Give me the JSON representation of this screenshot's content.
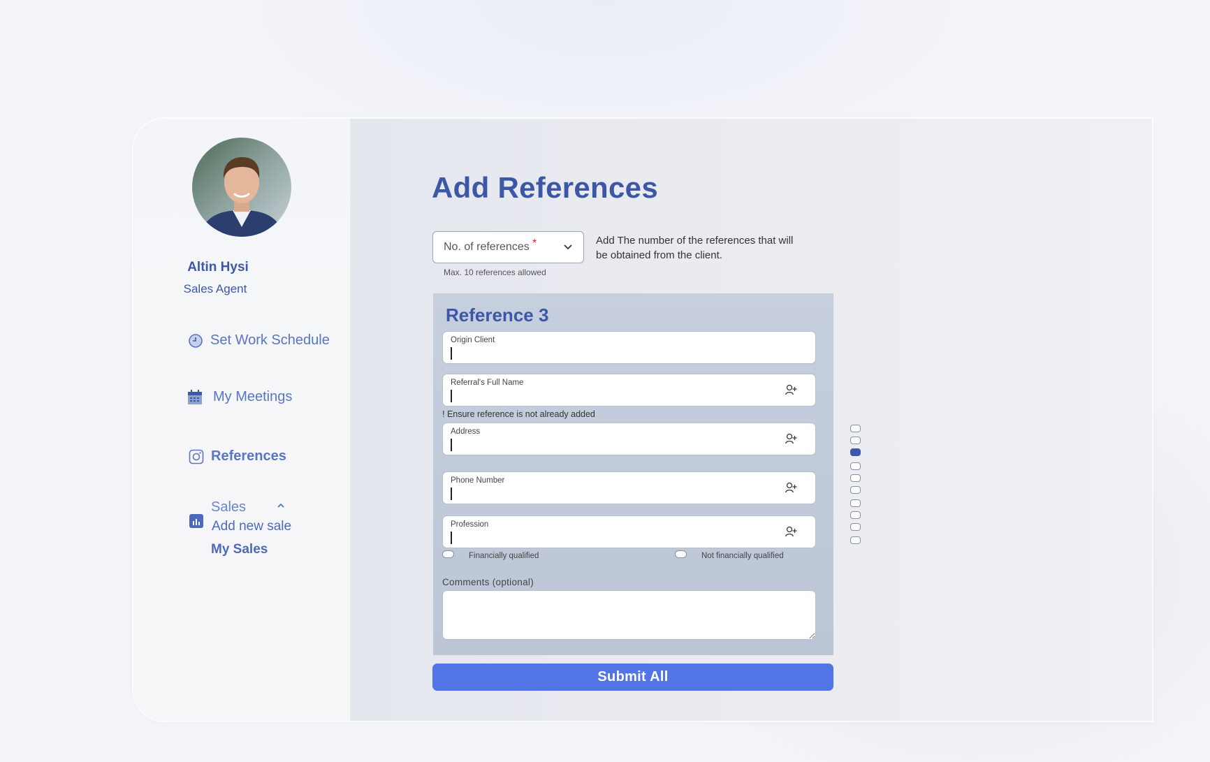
{
  "user": {
    "name": "Altin Hysi",
    "role": "Sales Agent"
  },
  "nav": {
    "schedule": "Set Work Schedule",
    "meetings": "My Meetings",
    "references": "References",
    "sales": "Sales",
    "sales_sub": [
      "Add new sale",
      "My Sales"
    ]
  },
  "topbar": {
    "icons": [
      "bell-icon",
      "mail-icon",
      "logout-icon"
    ]
  },
  "page": {
    "title": "Add References"
  },
  "references_select": {
    "label": "No. of references",
    "required_mark": "*",
    "hint": "Max. 10 references allowed",
    "help": "Add The number of the references that will be obtained from the client."
  },
  "reference_card": {
    "title": "Reference 3",
    "fields": {
      "origin_client": "Origin Client",
      "referral_name": "Referral's Full Name",
      "address": "Address",
      "phone": "Phone Number",
      "profession": "Profession"
    },
    "warning": "! Ensure reference is not already added",
    "radio_financial": "Financially qualified",
    "radio_not_financial": "Not financially qualified",
    "comments_label": "Comments (optional)"
  },
  "submit_label": "Submit All",
  "pager": {
    "total": 10,
    "active_index": 2
  },
  "colors": {
    "accent": "#3b57a5",
    "button": "#5275e6",
    "icon": "#5a75c2"
  }
}
